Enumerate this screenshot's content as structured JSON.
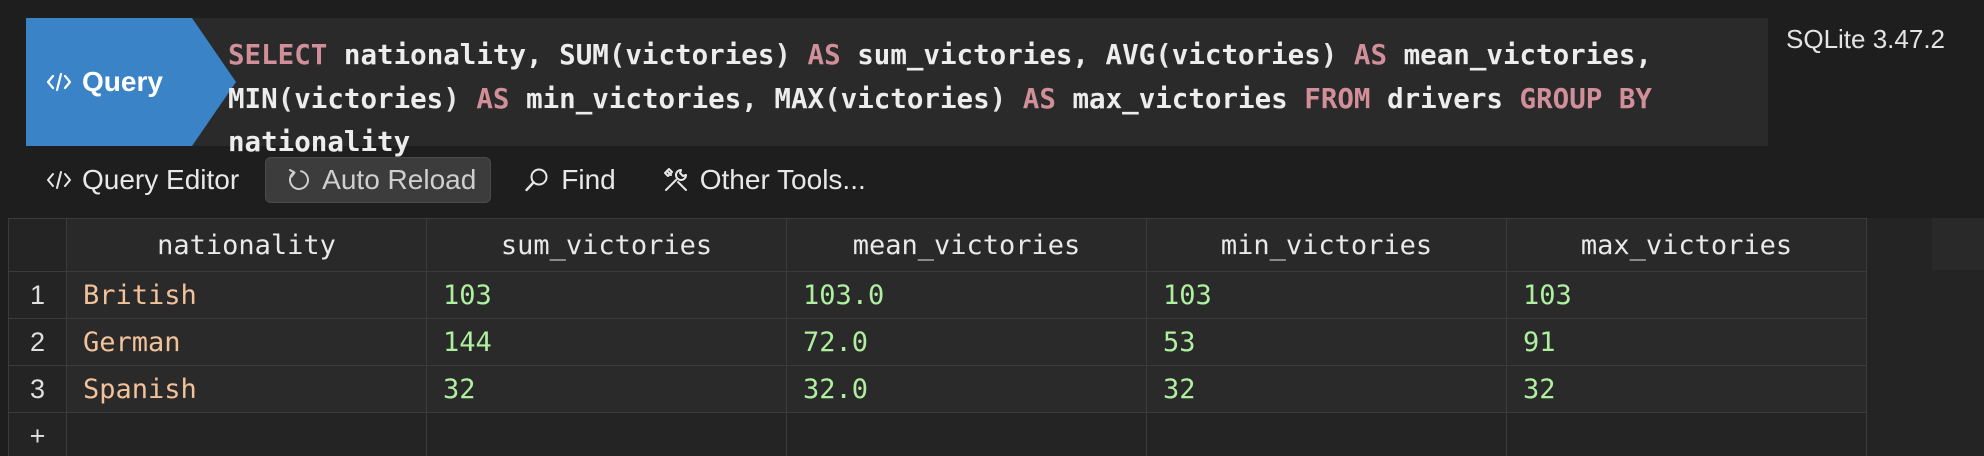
{
  "query": {
    "badge_label": "Query",
    "badge_icon": "code-icon",
    "sql_parts": {
      "p01": "SELECT",
      "p02": "nationality, SUM",
      "p03": "(",
      "p04": "victories",
      "p05": ")",
      "p06": "AS",
      "p07": "sum_victories, AVG",
      "p08": "(",
      "p09": "victories",
      "p10": ")",
      "p11": "AS",
      "p12": "mean_victories,",
      "p13": "MIN",
      "p14": "(",
      "p15": "victories",
      "p16": ")",
      "p17": "AS",
      "p18": "min_victories, MAX",
      "p19": "(",
      "p20": "victories",
      "p21": ")",
      "p22": "AS",
      "p23": "max_victories",
      "p24": "FROM",
      "p25": "drivers",
      "p26": "GROUP BY",
      "p27": "nationality"
    },
    "version": "SQLite 3.47.2"
  },
  "toolbar": {
    "query_editor": {
      "label": "Query Editor",
      "icon": "code-icon"
    },
    "auto_reload": {
      "label": "Auto Reload",
      "icon": "reload-icon"
    },
    "find": {
      "label": "Find",
      "icon": "search-icon"
    },
    "other_tools": {
      "label": "Other Tools...",
      "icon": "tools-icon"
    }
  },
  "table": {
    "columns": [
      "nationality",
      "sum_victories",
      "mean_victories",
      "min_victories",
      "max_victories"
    ],
    "rows": [
      {
        "num": "1",
        "cells": [
          "British",
          "103",
          "103.0",
          "103",
          "103"
        ]
      },
      {
        "num": "2",
        "cells": [
          "German",
          "144",
          "72.0",
          "53",
          "91"
        ]
      },
      {
        "num": "3",
        "cells": [
          "Spanish",
          "32",
          "32.0",
          "32",
          "32"
        ]
      }
    ],
    "add_row_symbol": "+"
  },
  "colors": {
    "accent": "#3a83c6",
    "keyword": "#d18f9a",
    "string_value": "#f2c29b",
    "number_value": "#aef0a0"
  }
}
